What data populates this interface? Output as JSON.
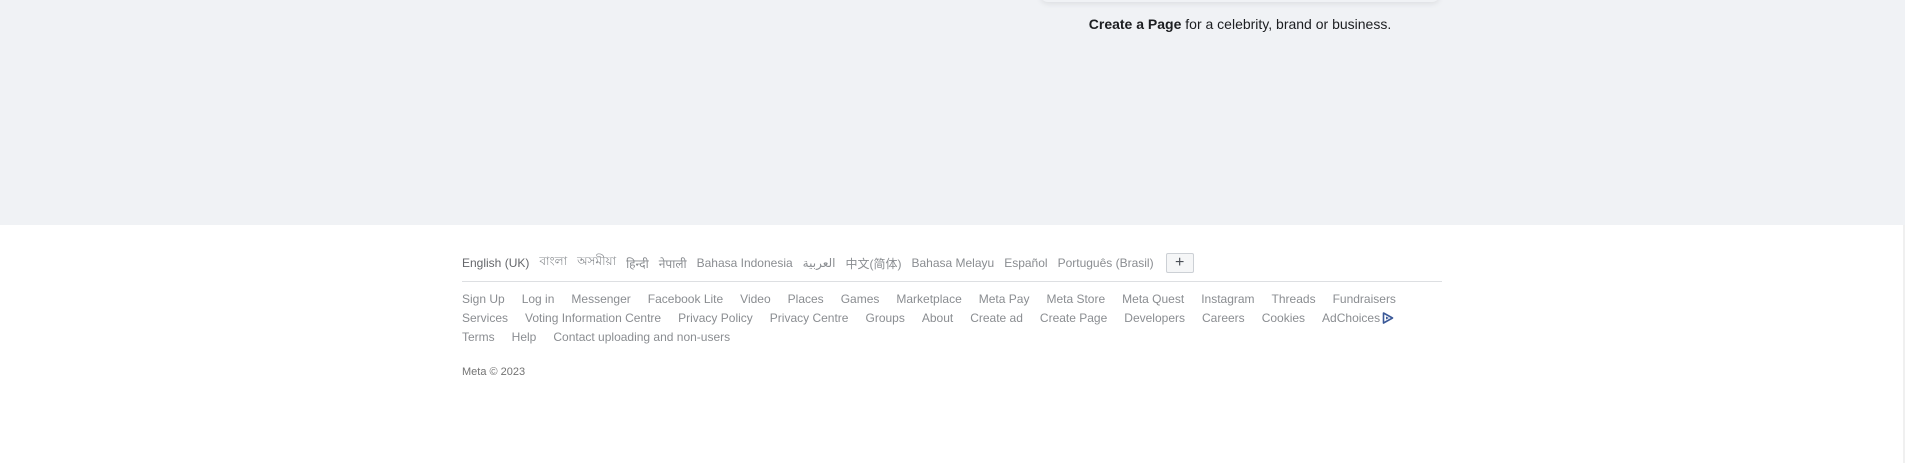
{
  "create_page": {
    "link_label": "Create a Page",
    "rest_text": " for a celebrity, brand or business."
  },
  "footer": {
    "languages": [
      "English (UK)",
      "বাংলা",
      "অসমীয়া",
      "हिन्दी",
      "नेपाली",
      "Bahasa Indonesia",
      "العربية",
      "中文(简体)",
      "Bahasa Melayu",
      "Español",
      "Português (Brasil)"
    ],
    "more_languages_label": "+",
    "links": [
      "Sign Up",
      "Log in",
      "Messenger",
      "Facebook Lite",
      "Video",
      "Places",
      "Games",
      "Marketplace",
      "Meta Pay",
      "Meta Store",
      "Meta Quest",
      "Instagram",
      "Threads",
      "Fundraisers",
      "Services",
      "Voting Information Centre",
      "Privacy Policy",
      "Privacy Centre",
      "Groups",
      "About",
      "Create ad",
      "Create Page",
      "Developers",
      "Careers",
      "Cookies",
      "AdChoices",
      "Terms",
      "Help",
      "Contact uploading and non-users"
    ],
    "adchoices_icon": "adchoices-triangle-icon",
    "copyright": "Meta © 2023"
  },
  "colors": {
    "page_background": "#f0f2f5",
    "footer_background": "#ffffff",
    "link_gray": "#8a8d91",
    "adchoices_blue": "#3b5998"
  }
}
